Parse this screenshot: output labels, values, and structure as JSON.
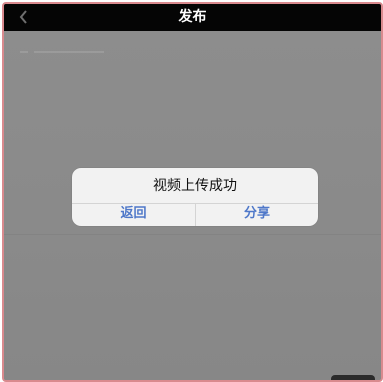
{
  "navbar": {
    "title": "发布",
    "back_icon": "chevron-left-icon"
  },
  "dialog": {
    "message": "视频上传成功",
    "buttons": {
      "back_label": "返回",
      "share_label": "分享"
    }
  },
  "colors": {
    "navbar_bg": "#050505",
    "overlay": "#8a8a8a",
    "dialog_bg": "#f2f2f2",
    "button_text": "#4f78c9",
    "frame_border": "#d98a8e"
  }
}
